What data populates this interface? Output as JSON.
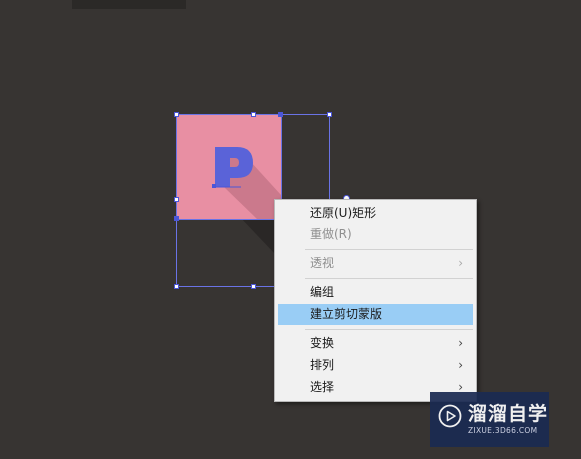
{
  "canvas": {
    "background": "#373432",
    "artwork_letter": "P",
    "accent_color": "#4b56d8",
    "square_color": "#e88fa3"
  },
  "context_menu": {
    "items": [
      {
        "label": "还原(U)矩形",
        "enabled": true,
        "submenu": false
      },
      {
        "label": "重做(R)",
        "enabled": false,
        "submenu": false
      },
      {
        "label": "透视",
        "enabled": false,
        "submenu": true
      },
      {
        "label": "编组",
        "enabled": true,
        "submenu": false
      },
      {
        "label": "建立剪切蒙版",
        "enabled": true,
        "submenu": false,
        "highlighted": true
      },
      {
        "label": "变换",
        "enabled": true,
        "submenu": true
      },
      {
        "label": "排列",
        "enabled": true,
        "submenu": true
      },
      {
        "label": "选择",
        "enabled": true,
        "submenu": true
      }
    ],
    "submenu_arrow": "›",
    "highlight_color": "#99cdf5"
  },
  "watermark": {
    "title": "溜溜自学",
    "url": "ZIXUE.3D66.COM",
    "icon": "play-icon"
  }
}
